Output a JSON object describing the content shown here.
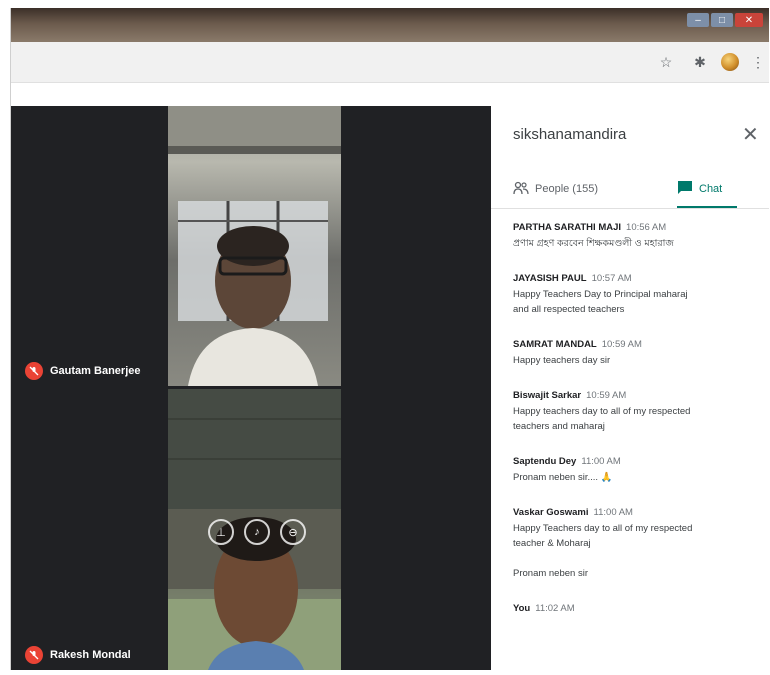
{
  "window": {
    "controls": [
      "minimize",
      "maximize",
      "close"
    ]
  },
  "toolbar": {
    "icons": [
      "star-icon",
      "puzzle-icon",
      "profile-avatar",
      "more-icon"
    ]
  },
  "participants": [
    {
      "name": "Gautam Banerjee",
      "muted": true
    },
    {
      "name": "Rakesh Mondal",
      "muted": true
    }
  ],
  "panel": {
    "meeting_name": "sikshanamandira",
    "close_icon": "close-icon",
    "tabs": {
      "people": "People (155)",
      "chat": "Chat"
    },
    "accent": "#00796b"
  },
  "messages": [
    {
      "sender": "PARTHA SARATHI MAJI",
      "time": "10:56 AM",
      "lines": [
        "প্রণাম গ্রহণ করবেন শিক্ষকমণ্ডলী ও মহারাজ"
      ]
    },
    {
      "sender": "JAYASISH PAUL",
      "time": "10:57 AM",
      "lines": [
        "Happy Teachers  Day to Principal maharaj",
        "and all respected teachers"
      ]
    },
    {
      "sender": "SAMRAT MANDAL",
      "time": "10:59 AM",
      "lines": [
        "Happy teachers day sir"
      ]
    },
    {
      "sender": "Biswajit Sarkar",
      "time": "10:59 AM",
      "lines": [
        "Happy teachers day to all of my respected",
        "teachers and maharaj"
      ]
    },
    {
      "sender": "Saptendu Dey",
      "time": "11:00 AM",
      "lines": [
        "Pronam neben sir.... 🙏"
      ]
    },
    {
      "sender": "Vaskar Goswami",
      "time": "11:00 AM",
      "lines": [
        "Happy Teachers day to all of my respected",
        "teacher & Moharaj",
        "",
        "Pronam neben sir"
      ]
    },
    {
      "sender": "You",
      "time": "11:02 AM",
      "lines": []
    }
  ],
  "colors": {
    "meeting_bg": "#202124",
    "mic_off": "#ea4335"
  }
}
